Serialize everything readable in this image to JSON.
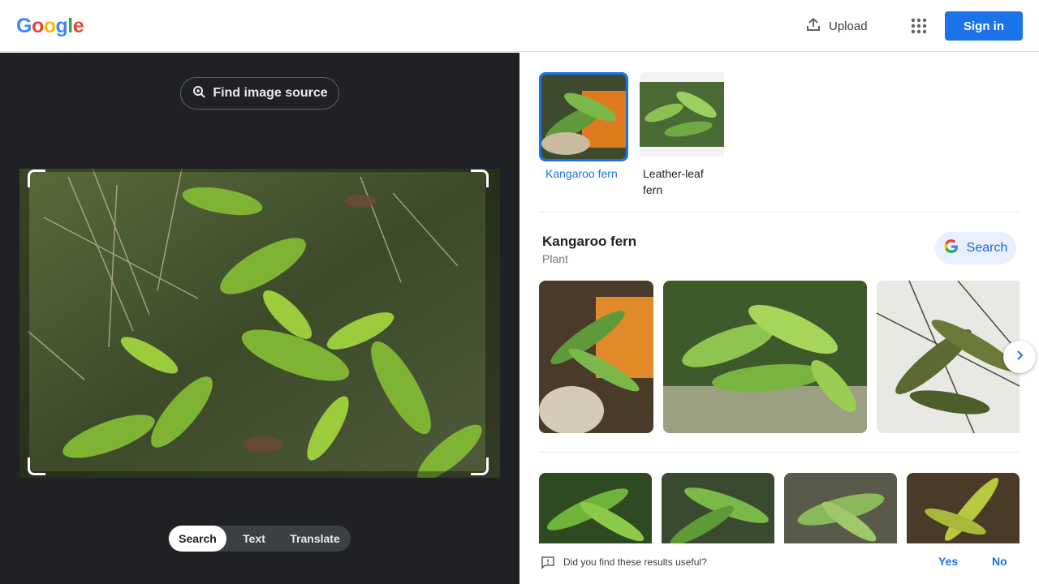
{
  "header": {
    "logo_letters": [
      {
        "ch": "G",
        "color": "#4285F4"
      },
      {
        "ch": "o",
        "color": "#EA4335"
      },
      {
        "ch": "o",
        "color": "#FBBC05"
      },
      {
        "ch": "g",
        "color": "#4285F4"
      },
      {
        "ch": "l",
        "color": "#34A853"
      },
      {
        "ch": "e",
        "color": "#EA4335"
      }
    ],
    "upload_label": "Upload",
    "upload_icon": "upload-icon",
    "apps_icon": "apps-grid-icon",
    "signin_label": "Sign in"
  },
  "left_panel": {
    "find_source_label": "Find image source",
    "find_source_icon": "lens-search-icon",
    "modes": [
      {
        "label": "Search",
        "active": true
      },
      {
        "label": "Text",
        "active": false
      },
      {
        "label": "Translate",
        "active": false
      }
    ]
  },
  "right_panel": {
    "suggestions": [
      {
        "label": "Kangaroo fern",
        "selected": true
      },
      {
        "label": "Leather-leaf fern",
        "selected": false
      }
    ],
    "entity": {
      "title": "Kangaroo fern",
      "subtitle": "Plant",
      "search_label": "Search",
      "search_icon": "google-g-icon"
    },
    "next_icon": "chevron-right-icon",
    "feedback": {
      "question": "Did you find these results useful?",
      "icon": "feedback-icon",
      "yes": "Yes",
      "no": "No"
    }
  },
  "colors": {
    "accent": "#1a73e8",
    "dark_bg": "#202124",
    "chip_bg": "#e8f0fe"
  }
}
